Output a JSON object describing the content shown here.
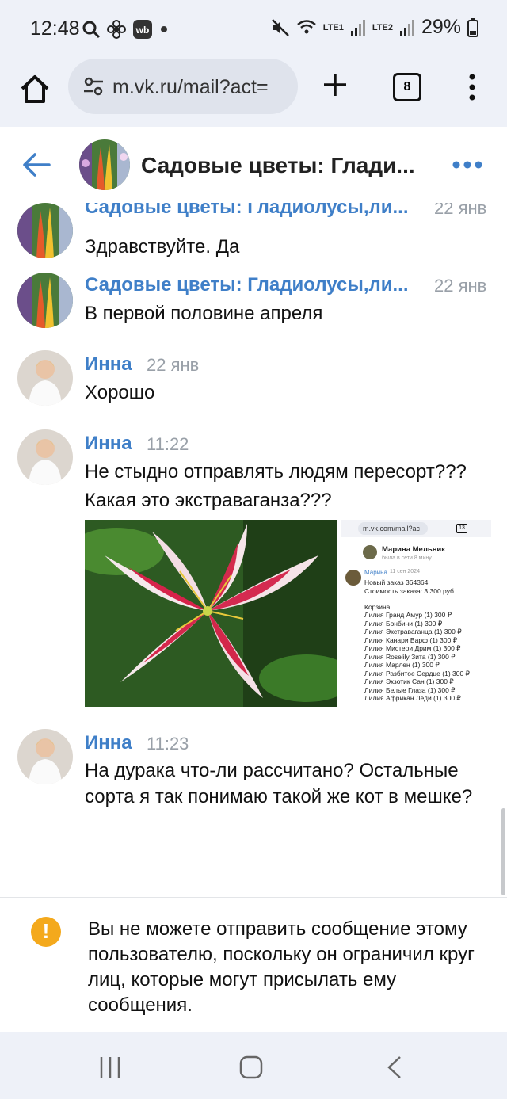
{
  "status_bar": {
    "time": "12:48",
    "battery": "29%",
    "sim1": "LTE1",
    "sim2": "LTE2",
    "left_icons": [
      "search-icon",
      "fan-icon",
      "wb-icon",
      "dot-icon"
    ]
  },
  "browser": {
    "url": "m.vk.ru/mail?act=",
    "tab_count": "8"
  },
  "chat": {
    "title": "Садовые цветы: Глади..."
  },
  "messages": [
    {
      "author": "Садовые цветы: Гладиолусы,ли...",
      "time": "22 янв",
      "text": "Здравствуйте. Да"
    },
    {
      "author": "Садовые цветы: Гладиолусы,ли...",
      "time": "22 янв",
      "text": "В первой половине апреля"
    },
    {
      "author": "Инна",
      "time": "22 янв",
      "text": "Хорошо"
    },
    {
      "author": "Инна",
      "time": "11:22",
      "text": "Не стыдно отправлять людям пересорт???Какая это экстраваганза???"
    },
    {
      "author": "Инна",
      "time": "11:23",
      "text": "На дурака что-ли рассчитано? Остальные сорта я так понимаю такой же кот в мешке?"
    }
  ],
  "screenshot_attachment": {
    "url": "m.vk.com/mail?ac",
    "tabs": "13",
    "contact": "Марина Мельник",
    "last_seen": "была в сети 8 мину...",
    "author": "Марина",
    "date": "11 сен 2024",
    "lines": [
      "Новый заказ 364364",
      "Стоимость заказа: 3 300 руб.",
      "",
      "Корзина:",
      "Лилия Гранд Амур (1) 300 ₽",
      "Лилия Бонбини (1) 300 ₽",
      "Лилия Экстраваганца (1) 300 ₽",
      "Лилия Канари Варф (1) 300 ₽",
      "Лилия Мистери Дрим (1) 300 ₽",
      "Лилия Roselily Зита (1) 300 ₽",
      "Лилия Марлен (1) 300 ₽",
      "Лилия Разбитое Сердце (1) 300 ₽",
      "Лилия Экзотик Сан (1) 300 ₽",
      "Лилия Белые Глаза (1) 300 ₽",
      "Лилия Африкан Леди (1) 300 ₽"
    ]
  },
  "notice": {
    "text": "Вы не можете отправить сообщение этому пользователю, поскольку он ограничил круг лиц, которые могут присылать ему сообщения."
  },
  "colors": {
    "accent": "#3f7fc8",
    "warning": "#f4a91c",
    "chrome_bg": "#eef1f8"
  }
}
